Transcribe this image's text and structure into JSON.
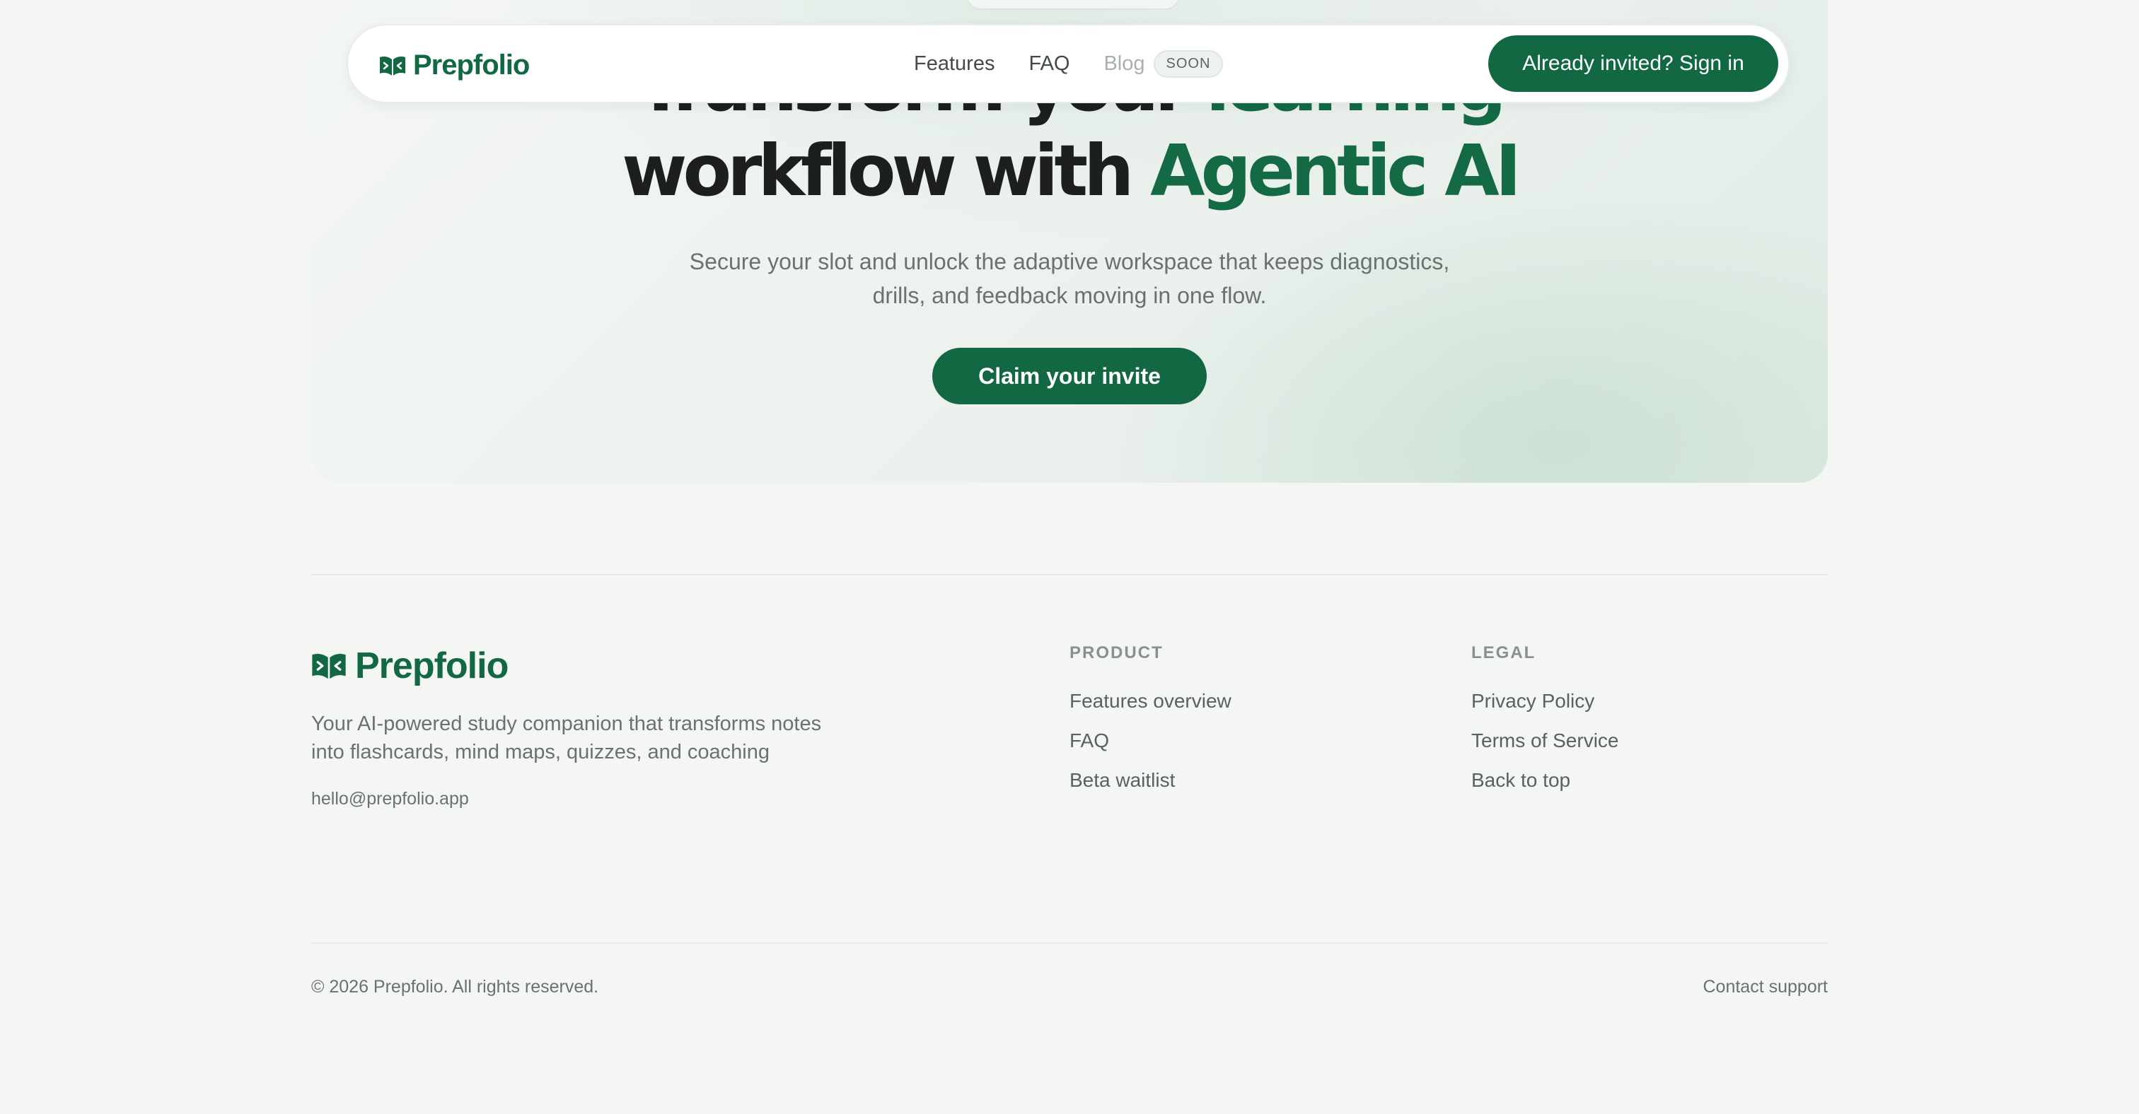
{
  "nav": {
    "brand": "Prepfolio",
    "links": [
      "Features",
      "FAQ"
    ],
    "blog_label": "Blog",
    "soon_badge": "SOON",
    "signin_label": "Already invited? Sign in"
  },
  "hero": {
    "title_line1_dark": "Transform your",
    "title_line1_green": "learning",
    "title_line2_dark": "workflow with",
    "title_line2_green": "Agentic AI",
    "subtitle_line1": "Secure your slot and unlock the adaptive workspace that keeps diagnostics,",
    "subtitle_line2": "drills, and feedback moving in one flow.",
    "cta_label": "Claim your invite"
  },
  "footer": {
    "brand": "Prepfolio",
    "description_line1": "Your AI-powered study companion that transforms notes",
    "description_line2": "into flashcards, mind maps, quizzes, and coaching",
    "email": "hello@prepfolio.app",
    "product": {
      "heading": "PRODUCT",
      "links": [
        "Features overview",
        "FAQ",
        "Beta waitlist"
      ]
    },
    "legal": {
      "heading": "LEGAL",
      "links": [
        "Privacy Policy",
        "Terms of Service",
        "Back to top"
      ]
    },
    "copyright": "© 2026 Prepfolio. All rights reserved.",
    "contact_support": "Contact support"
  },
  "colors": {
    "brand_green": "#126842",
    "accent_green": "#146a45",
    "page_background": "#f4f6f4",
    "muted_text": "#6b716d"
  },
  "icons": {
    "logo": "open-book-icon"
  }
}
